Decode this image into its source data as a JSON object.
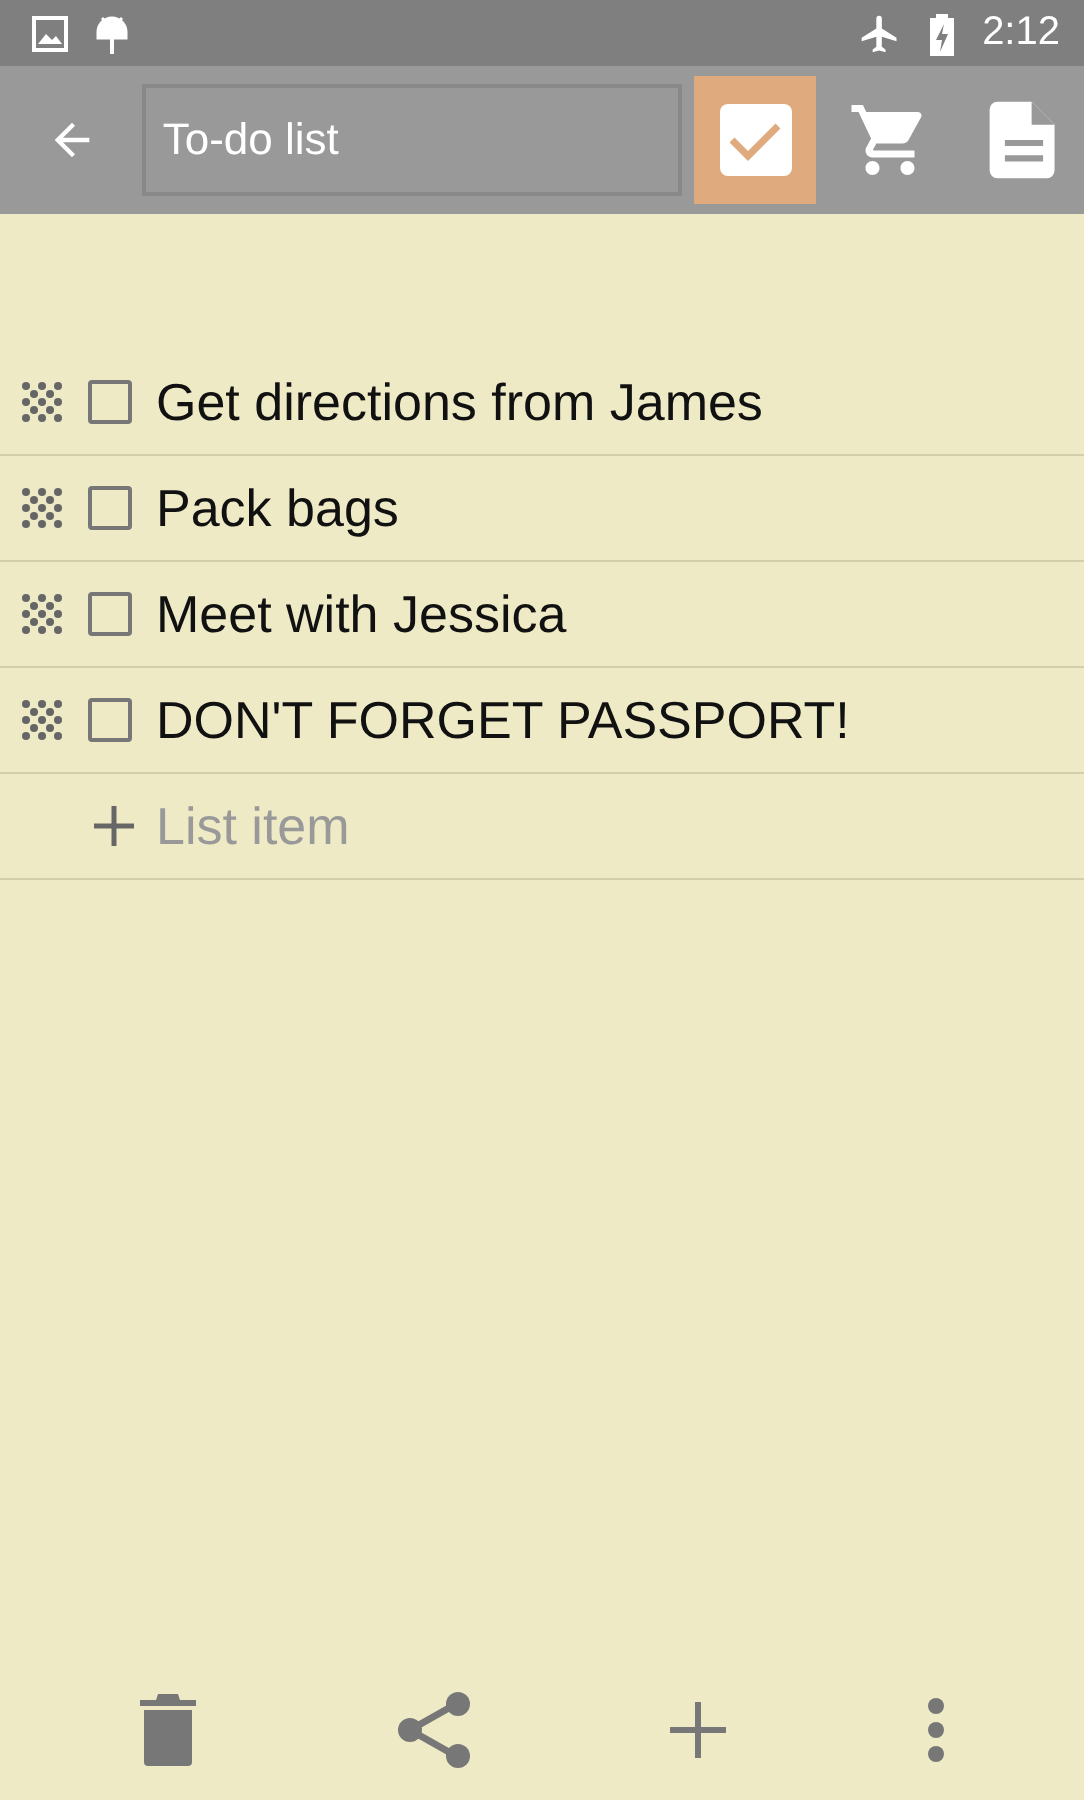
{
  "status_bar": {
    "time": "2:12"
  },
  "toolbar": {
    "title_field": {
      "value": "To-do list"
    },
    "modes": [
      {
        "kind": "checklist",
        "selected": true
      },
      {
        "kind": "cart",
        "selected": false
      },
      {
        "kind": "note",
        "selected": false
      }
    ]
  },
  "items": [
    {
      "text": "Get directions from James",
      "checked": false
    },
    {
      "text": "Pack bags",
      "checked": false
    },
    {
      "text": "Meet with Jessica",
      "checked": false
    },
    {
      "text": "DON'T FORGET PASSPORT!",
      "checked": false
    }
  ],
  "add_item": {
    "placeholder": "List item"
  }
}
